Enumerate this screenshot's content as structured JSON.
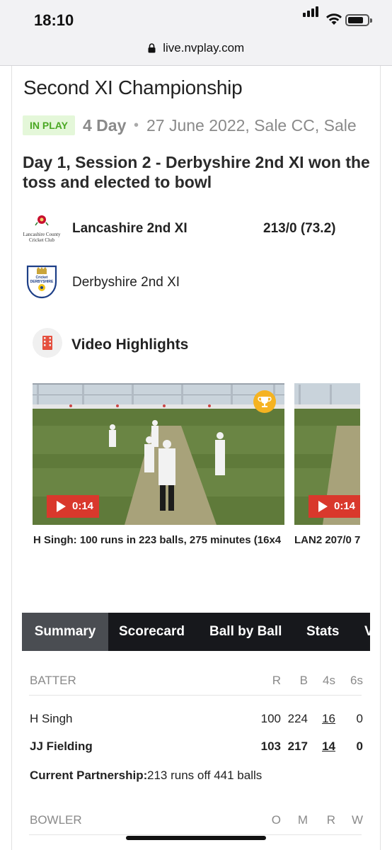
{
  "status_bar": {
    "time": "18:10"
  },
  "browser": {
    "url": "live.nvplay.com"
  },
  "match": {
    "competition": "Second XI Championship",
    "status_badge": "IN PLAY",
    "format": "4 Day",
    "separator": "•",
    "date_venue": "27 June 2022, Sale CC, Sale",
    "session_text": "Day 1, Session 2 - Derbyshire 2nd XI won the toss and elected to bowl"
  },
  "teams": [
    {
      "name": "Lancashire 2nd XI",
      "score": "213/0 (73.2)",
      "logo_text": [
        "Lancashire County",
        "Cricket Club"
      ]
    },
    {
      "name": "Derbyshire 2nd XI",
      "score": "",
      "logo_text": [
        "Cricket",
        "DERBYSHIRE"
      ]
    }
  ],
  "highlights": {
    "title": "Video Highlights",
    "videos": [
      {
        "duration": "0:14",
        "caption": "H Singh: 100 runs in 223 balls, 275 minutes (16x4",
        "trophy": true
      },
      {
        "duration": "0:14",
        "caption": "LAN2 207/0 7",
        "trophy": false
      }
    ]
  },
  "tabs": [
    "Summary",
    "Scorecard",
    "Ball by Ball",
    "Stats",
    "V"
  ],
  "active_tab": "Summary",
  "batting": {
    "headers": [
      "BATTER",
      "R",
      "B",
      "4s",
      "6s"
    ],
    "rows": [
      {
        "name": "H Singh",
        "r": "100",
        "b": "224",
        "fours": "16",
        "sixes": "0",
        "on_strike": false
      },
      {
        "name": "JJ Fielding",
        "r": "103",
        "b": "217",
        "fours": "14",
        "sixes": "0",
        "on_strike": true
      }
    ],
    "partnership_label": "Current Partnership:",
    "partnership_value": "213 runs off 441 balls"
  },
  "bowling": {
    "headers": [
      "BOWLER",
      "O",
      "M",
      "R",
      "W"
    ]
  },
  "colors": {
    "accent_red": "#d9382c",
    "badge_green": "#4aa823",
    "tab_bar": "#17181c",
    "trophy": "#f5b321"
  }
}
